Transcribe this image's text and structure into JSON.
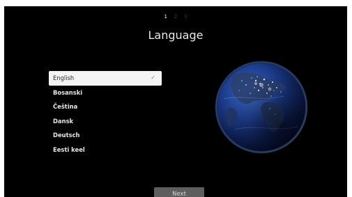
{
  "setup": {
    "steps": [
      "1",
      "2",
      "3"
    ],
    "active_step": 1,
    "title": "Language"
  },
  "languages": {
    "items": [
      "English",
      "Bosanski",
      "Čeština",
      "Dansk",
      "Deutsch",
      "Eesti keel"
    ],
    "selected": "English",
    "check_mark": "✓"
  },
  "footer": {
    "next_label": "Next"
  },
  "colors": {
    "background": "#000000",
    "selected_row": "#f4f4f4",
    "next_button": "#5e5e5e"
  },
  "icons": {
    "selected_indicator": "check-icon",
    "illustration": "earth-globe-image"
  }
}
